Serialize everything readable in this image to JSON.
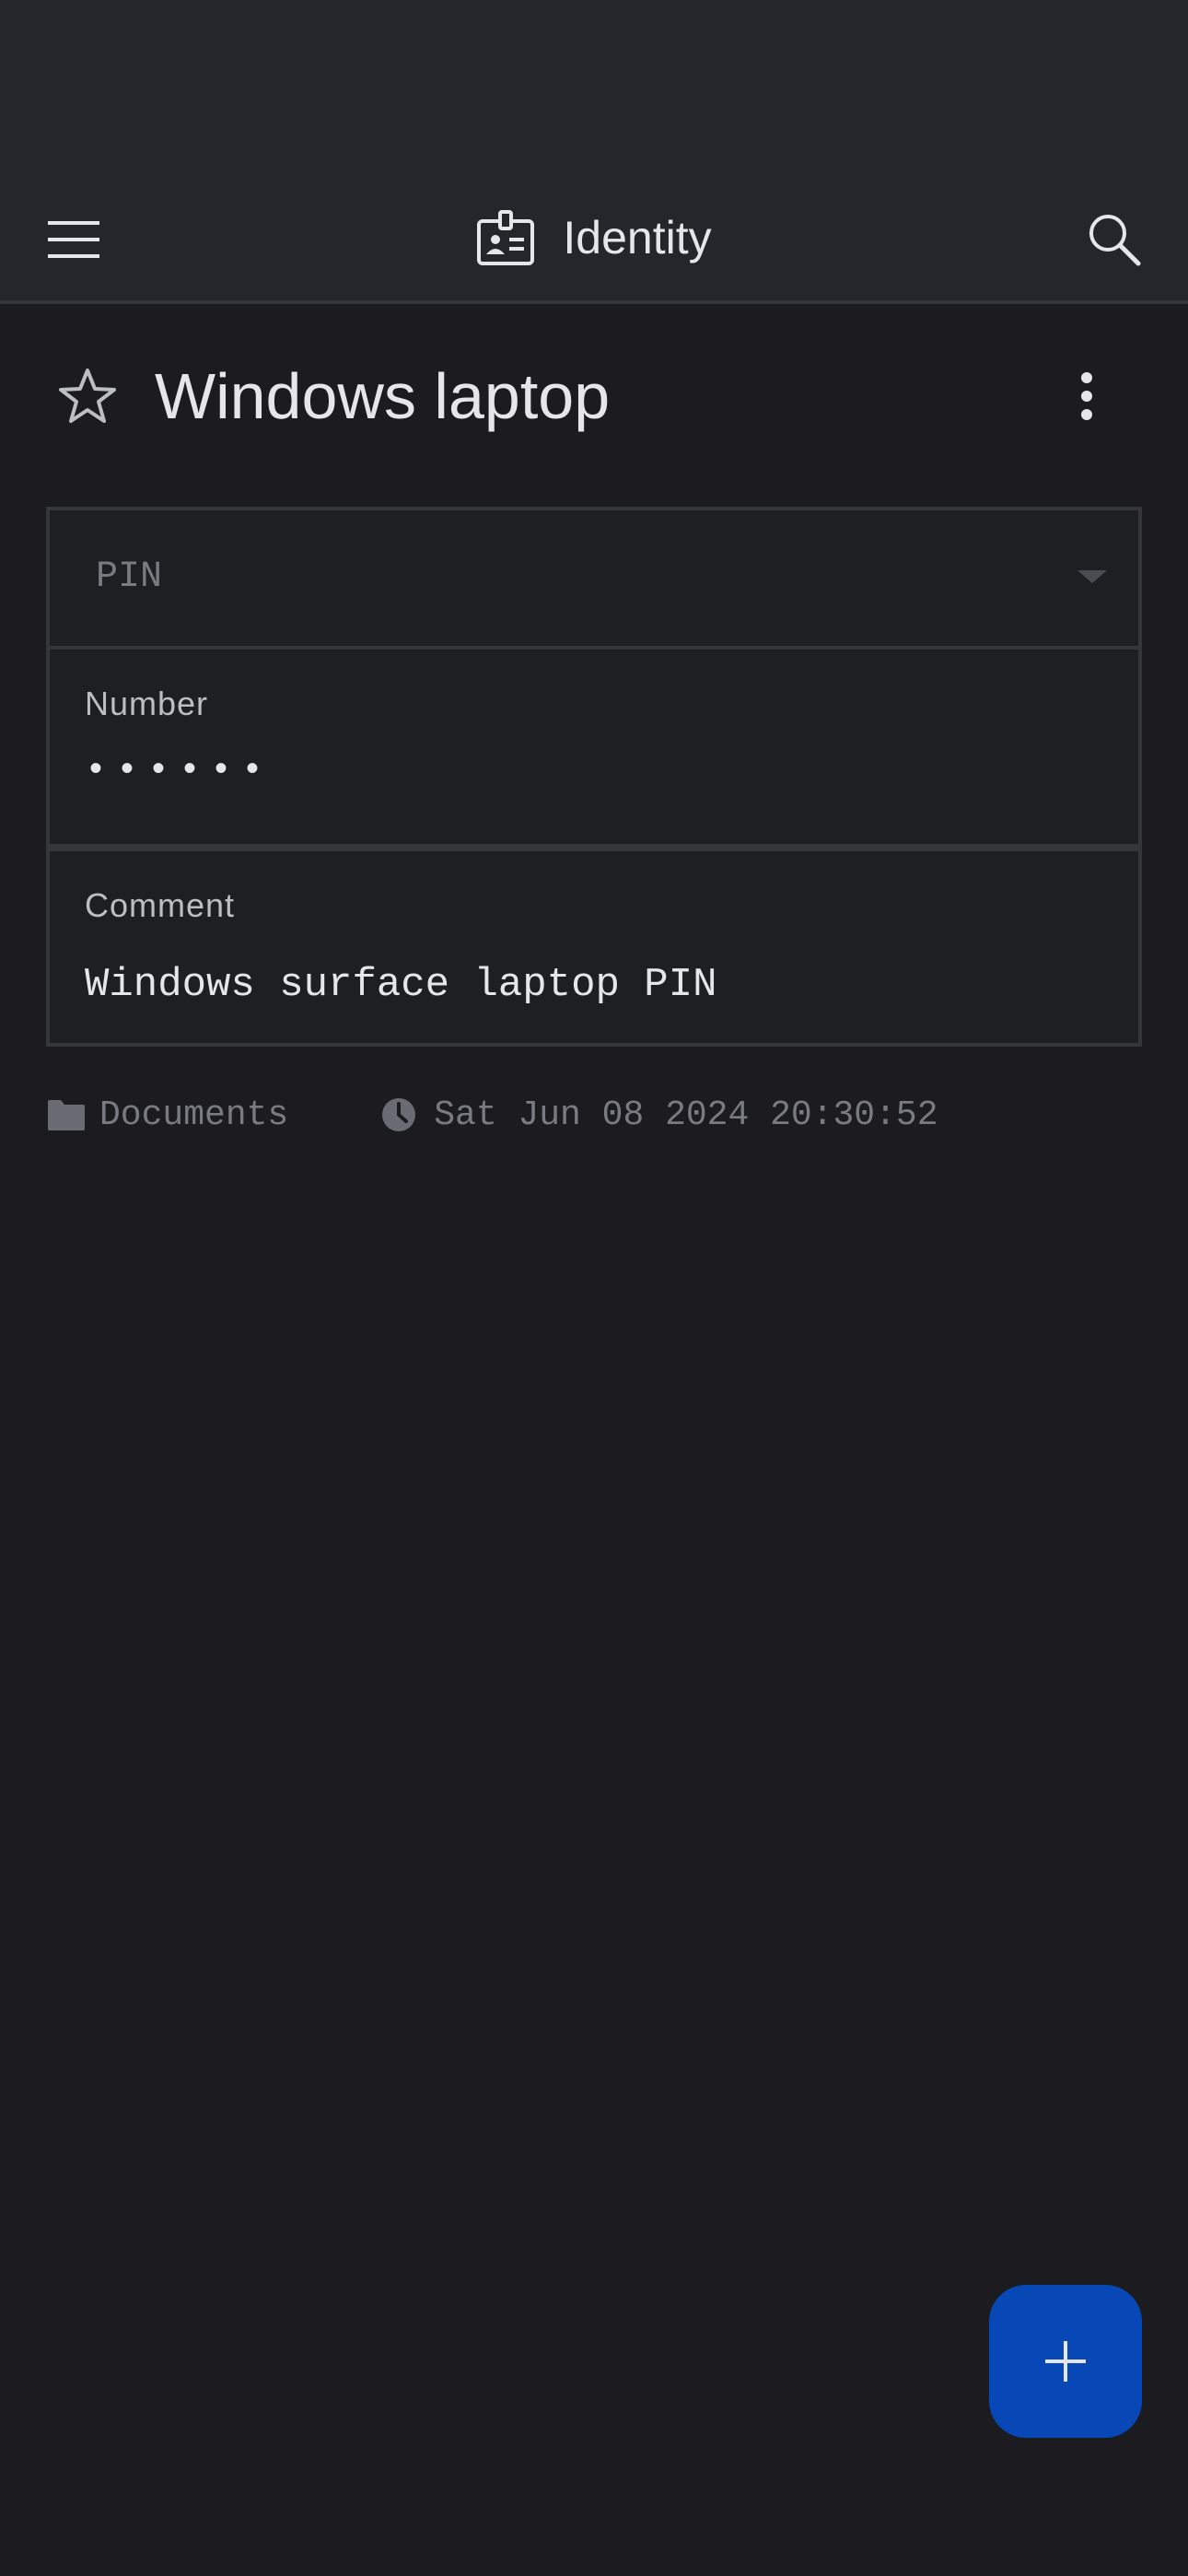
{
  "header": {
    "title": "Identity",
    "title_icon": "id-badge-icon",
    "menu_icon": "hamburger-menu-icon",
    "search_icon": "search-icon"
  },
  "entry": {
    "title": "Windows laptop",
    "favorite_icon": "star-outline-icon",
    "more_icon": "more-vertical-icon",
    "type": "PIN",
    "fields": {
      "number_label": "Number",
      "number_value": "••••••",
      "comment_label": "Comment",
      "comment_value": "Windows surface laptop PIN"
    },
    "meta": {
      "folder": "Documents",
      "timestamp": "Sat Jun 08 2024 20:30:52"
    }
  },
  "fab": {
    "icon": "plus-icon"
  },
  "colors": {
    "background": "#1c1c20",
    "app_bar": "#25262b",
    "accent": "#0747b6",
    "muted_text": "#7a7b82"
  }
}
